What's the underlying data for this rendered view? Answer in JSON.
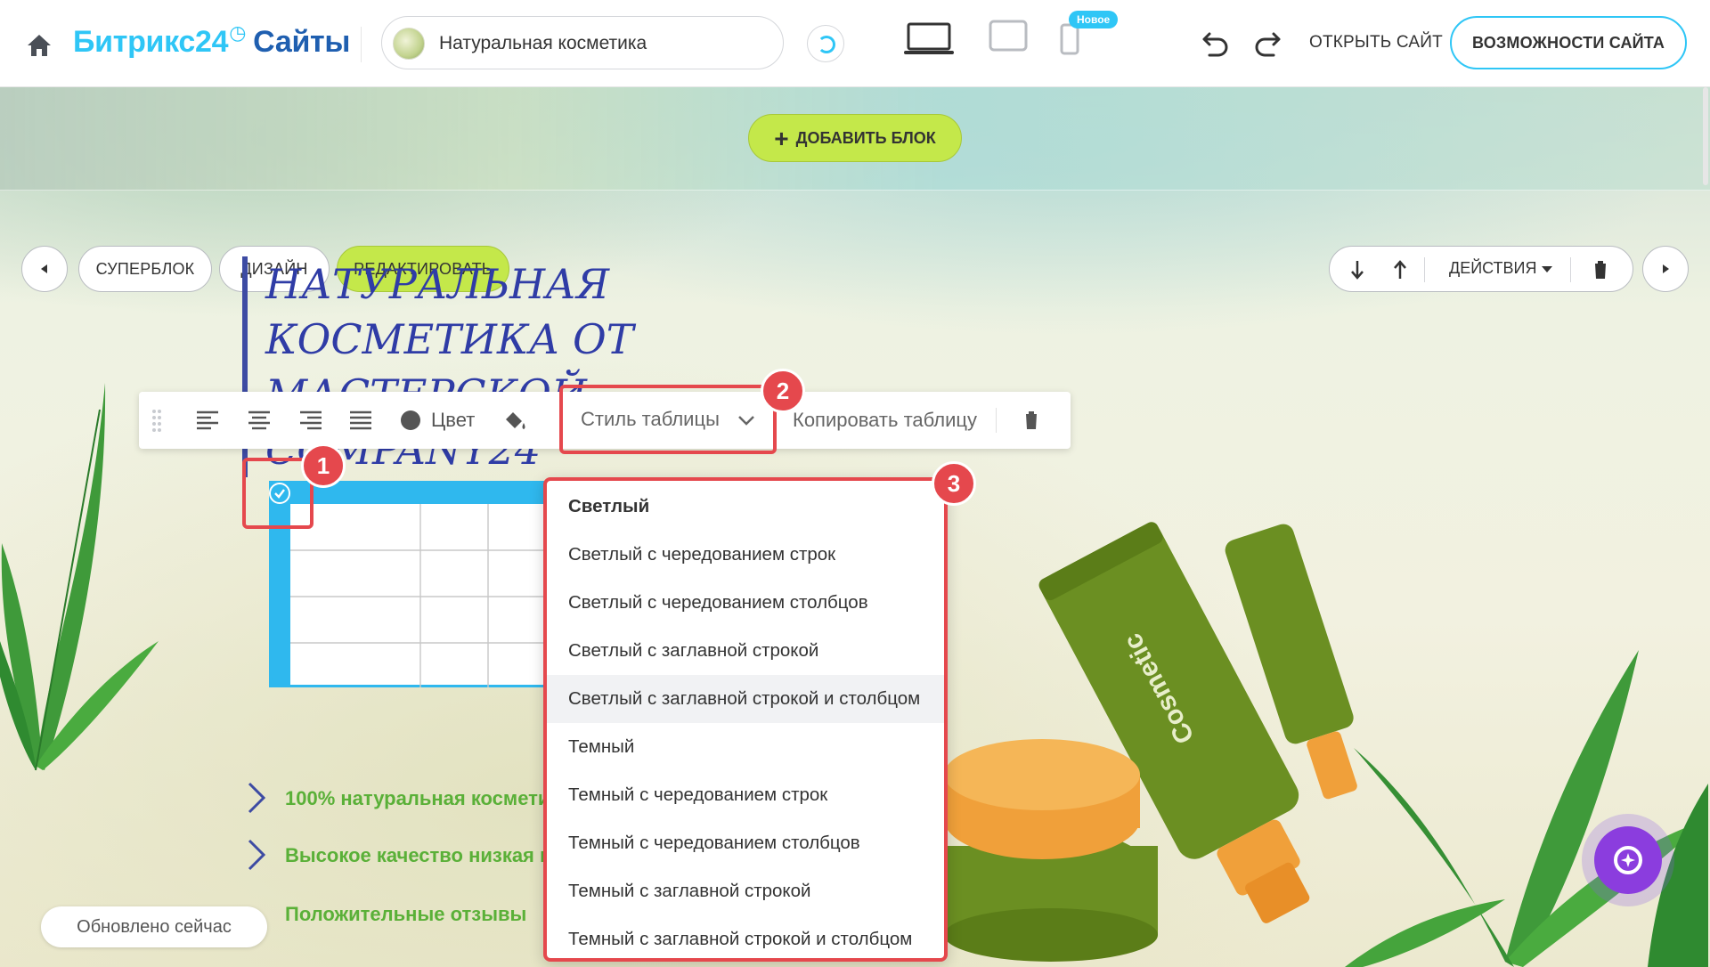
{
  "header": {
    "brand_main": "Битрикс24",
    "brand_clock": "◷",
    "brand_sub": "Сайты",
    "site_name": "Натуральная косметика",
    "new_badge": "Новое",
    "open_site": "ОТКРЫТЬ САЙТ",
    "features": "ВОЗМОЖНОСТИ САЙТА"
  },
  "canvas": {
    "add_block": "ДОБАВИТЬ БЛОК",
    "superblock": "СУПЕРБЛОК",
    "design": "ДИЗАЙН",
    "edit": "РЕДАКТИРОВАТЬ",
    "actions": "ДЕЙСТВИЯ",
    "heading_line1": "НАТУРАЛЬНАЯ КОСМЕТИКА ОТ",
    "heading_line2": "МАСТЕРСКОЙ COMPANY24"
  },
  "table_toolbar": {
    "color": "Цвет",
    "table_style": "Стиль таблицы",
    "copy_table": "Копировать таблицу"
  },
  "table_style_options": [
    {
      "label": "Светлый",
      "selected": true
    },
    {
      "label": "Светлый с чередованием строк"
    },
    {
      "label": "Светлый с чередованием столбцов"
    },
    {
      "label": "Светлый с заглавной строкой"
    },
    {
      "label": "Светлый с заглавной строкой и столбцом",
      "hover": true
    },
    {
      "label": "Темный"
    },
    {
      "label": "Темный с чередованием строк"
    },
    {
      "label": "Темный с чередованием столбцов"
    },
    {
      "label": "Темный с заглавной строкой"
    },
    {
      "label": "Темный с заглавной строкой и столбцом"
    }
  ],
  "bullets": [
    "100% натуральная космети",
    "Высокое качество низкая ц",
    "Положительные отзывы"
  ],
  "steps": [
    "1",
    "2",
    "3"
  ],
  "status": "Обновлено сейчас",
  "colors": {
    "accent": "#2fc6f6",
    "brand_dark": "#1f5fb0",
    "highlight": "#e5484d",
    "lime": "#c4e84a",
    "heading": "#2f3ca6"
  }
}
